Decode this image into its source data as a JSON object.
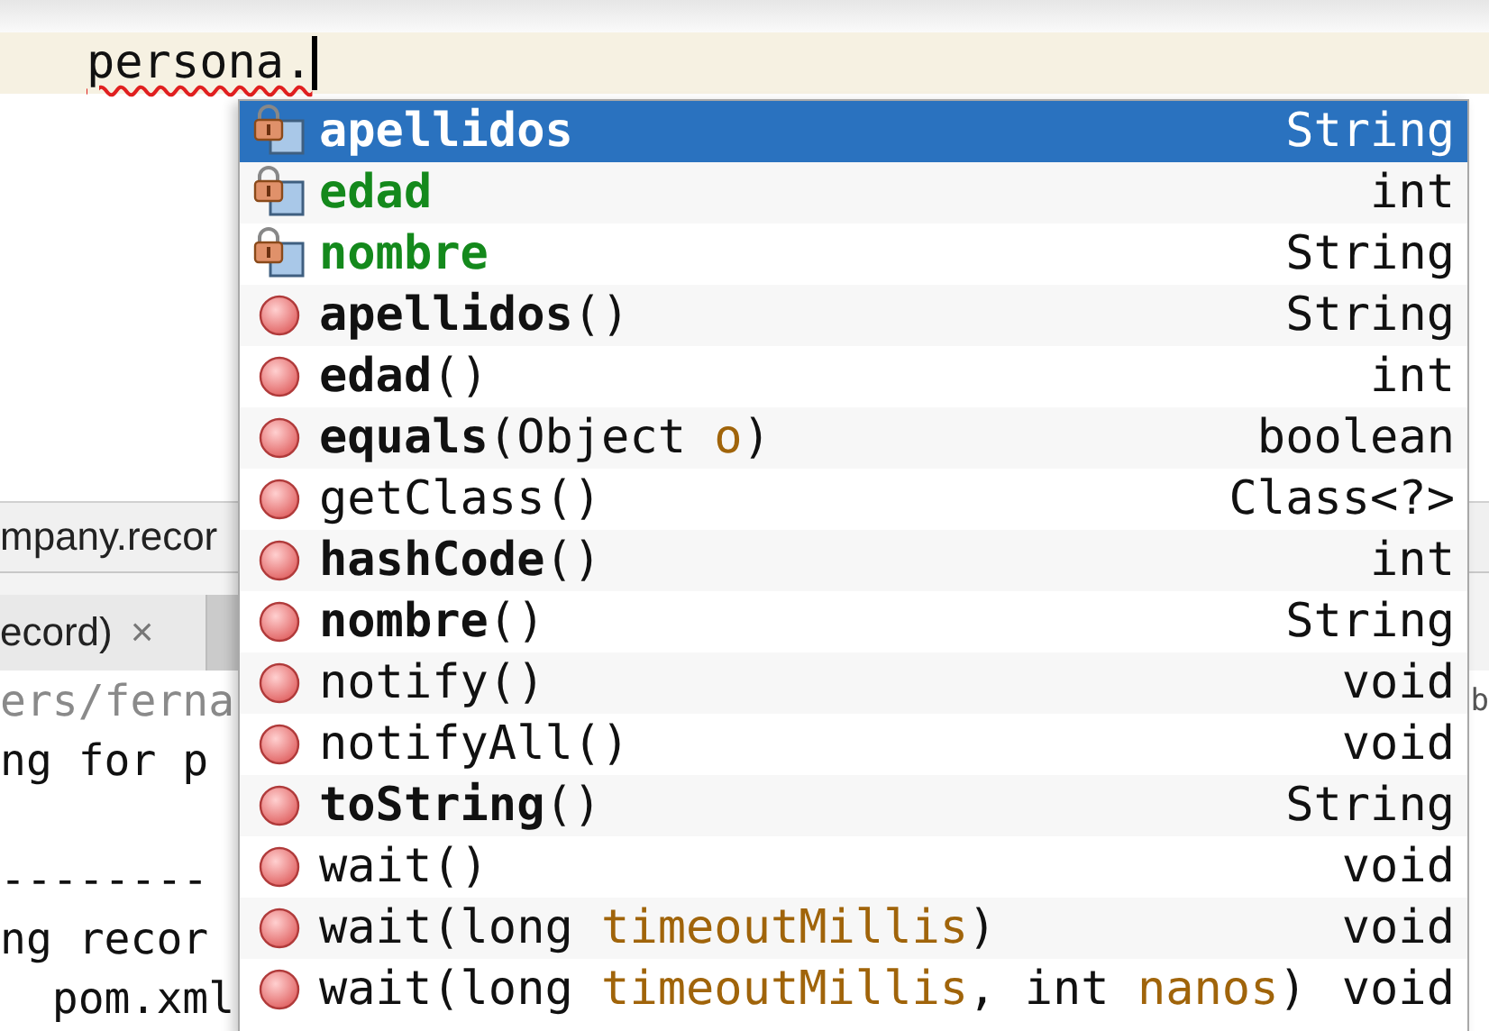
{
  "editor": {
    "line": {
      "text": "persona.",
      "error": true
    }
  },
  "project_tab": {
    "label": "mpany.recor"
  },
  "output_tab": {
    "label": "ecord)",
    "close": "×"
  },
  "output_lines": [
    {
      "text": "ers/ferna",
      "dim": true,
      "trailing": "b"
    },
    {
      "text": "ng for p",
      "dim": false
    },
    {
      "text": "--------",
      "dim": false,
      "blank_line_before": true
    },
    {
      "text": "ng recor",
      "dim": false
    },
    {
      "text": "  pom.xml",
      "dim": false
    }
  ],
  "completion_popup": {
    "items": [
      {
        "kind": "field",
        "name": "apellidos",
        "bold": true,
        "selected": true,
        "return_type": "String"
      },
      {
        "kind": "field",
        "name": "edad",
        "bold": true,
        "selected": false,
        "return_type": "int"
      },
      {
        "kind": "field",
        "name": "nombre",
        "bold": true,
        "selected": false,
        "return_type": "String"
      },
      {
        "kind": "method",
        "name": "apellidos",
        "bold": true,
        "selected": false,
        "signature": [
          {
            "text": "()",
            "kind": "plain"
          }
        ],
        "return_type": "String"
      },
      {
        "kind": "method",
        "name": "edad",
        "bold": true,
        "selected": false,
        "signature": [
          {
            "text": "()",
            "kind": "plain"
          }
        ],
        "return_type": "int"
      },
      {
        "kind": "method",
        "name": "equals",
        "bold": true,
        "selected": false,
        "signature": [
          {
            "text": "(Object ",
            "kind": "plain"
          },
          {
            "text": "o",
            "kind": "param"
          },
          {
            "text": ")",
            "kind": "plain"
          }
        ],
        "return_type": "boolean"
      },
      {
        "kind": "method",
        "name": "getClass",
        "bold": false,
        "selected": false,
        "signature": [
          {
            "text": "()",
            "kind": "plain"
          }
        ],
        "return_type": "Class<?>"
      },
      {
        "kind": "method",
        "name": "hashCode",
        "bold": true,
        "selected": false,
        "signature": [
          {
            "text": "()",
            "kind": "plain"
          }
        ],
        "return_type": "int"
      },
      {
        "kind": "method",
        "name": "nombre",
        "bold": true,
        "selected": false,
        "signature": [
          {
            "text": "()",
            "kind": "plain"
          }
        ],
        "return_type": "String"
      },
      {
        "kind": "method",
        "name": "notify",
        "bold": false,
        "selected": false,
        "signature": [
          {
            "text": "()",
            "kind": "plain"
          }
        ],
        "return_type": "void"
      },
      {
        "kind": "method",
        "name": "notifyAll",
        "bold": false,
        "selected": false,
        "signature": [
          {
            "text": "()",
            "kind": "plain"
          }
        ],
        "return_type": "void"
      },
      {
        "kind": "method",
        "name": "toString",
        "bold": true,
        "selected": false,
        "signature": [
          {
            "text": "()",
            "kind": "plain"
          }
        ],
        "return_type": "String"
      },
      {
        "kind": "method",
        "name": "wait",
        "bold": false,
        "selected": false,
        "signature": [
          {
            "text": "()",
            "kind": "plain"
          }
        ],
        "return_type": "void"
      },
      {
        "kind": "method",
        "name": "wait",
        "bold": false,
        "selected": false,
        "signature": [
          {
            "text": "(long ",
            "kind": "plain"
          },
          {
            "text": "timeoutMillis",
            "kind": "param"
          },
          {
            "text": ")",
            "kind": "plain"
          }
        ],
        "return_type": "void"
      },
      {
        "kind": "method",
        "name": "wait",
        "bold": false,
        "selected": false,
        "signature": [
          {
            "text": "(long ",
            "kind": "plain"
          },
          {
            "text": "timeoutMillis",
            "kind": "param"
          },
          {
            "text": ", int ",
            "kind": "plain"
          },
          {
            "text": "nanos",
            "kind": "param"
          },
          {
            "text": ")",
            "kind": "plain"
          }
        ],
        "return_type": "void"
      }
    ]
  }
}
